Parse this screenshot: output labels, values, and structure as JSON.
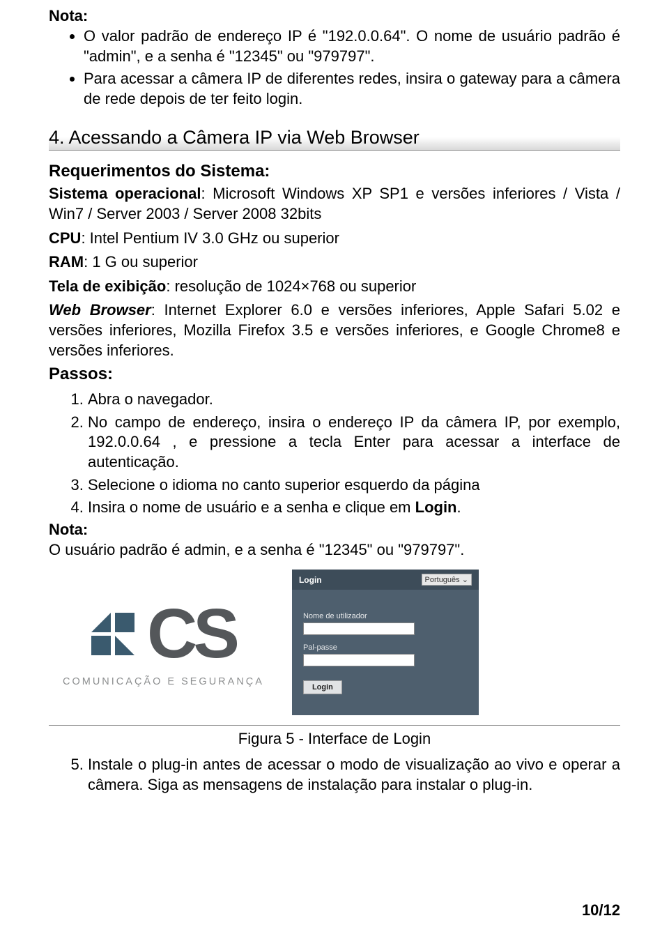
{
  "nota_label": "Nota:",
  "bullets": [
    "O valor padrão de endereço IP é \"192.0.0.64\". O nome de usuário padrão é \"admin\", e a senha é \"12345\" ou \"979797\".",
    "Para acessar a câmera IP de diferentes redes, insira o gateway para a câmera de rede depois de ter feito login."
  ],
  "section4_heading": "4. Acessando a Câmera IP via Web Browser",
  "req_heading": "Requerimentos do Sistema:",
  "req_os_label": "Sistema operacional",
  "req_os_text": ": Microsoft Windows XP SP1 e versões inferiores / Vista / Win7 / Server 2003 / Server 2008 32bits",
  "req_cpu_label": "CPU",
  "req_cpu_text": ": Intel Pentium IV 3.0 GHz ou superior",
  "req_ram_label": "RAM",
  "req_ram_text": ": 1 G ou superior",
  "req_disp_label": "Tela de exibição",
  "req_disp_text": ": resolução de 1024×768 ou superior",
  "req_browser_label": "Web Browser",
  "req_browser_text": ": Internet Explorer 6.0 e versões inferiores, Apple Safari 5.02 e versões inferiores, Mozilla Firefox 3.5 e versões inferiores, e Google Chrome8 e versões inferiores.",
  "passos_label": "Passos:",
  "steps": [
    "Abra o navegador.",
    "No campo de endereço, insira o endereço IP da câmera IP, por exemplo, 192.0.0.64 , e pressione a tecla Enter para acessar a interface de autenticação.",
    "Selecione o idioma no canto superior esquerdo da página",
    "Insira o nome de usuário e a senha e clique em Login."
  ],
  "step4_suffix_bold": "Login",
  "nota2_label": "Nota:",
  "nota2_text": "O usuário padrão é admin, e a senha é \"12345\" ou \"979797\".",
  "login_ui": {
    "logo_letters": "CS",
    "logo_subtitle": "COMUNICAÇÃO E SEGURANÇA",
    "panel_title": "Login",
    "language": "Português",
    "username_label": "Nome de utilizador",
    "password_label": "Pal-passe",
    "login_button": "Login"
  },
  "figure_caption": "Figura 5 - Interface de Login",
  "step5": "Instale o plug-in antes de acessar o modo de visualização ao vivo e operar a câmera. Siga as mensagens de instalação para instalar o plug-in.",
  "page_number": "10/12"
}
